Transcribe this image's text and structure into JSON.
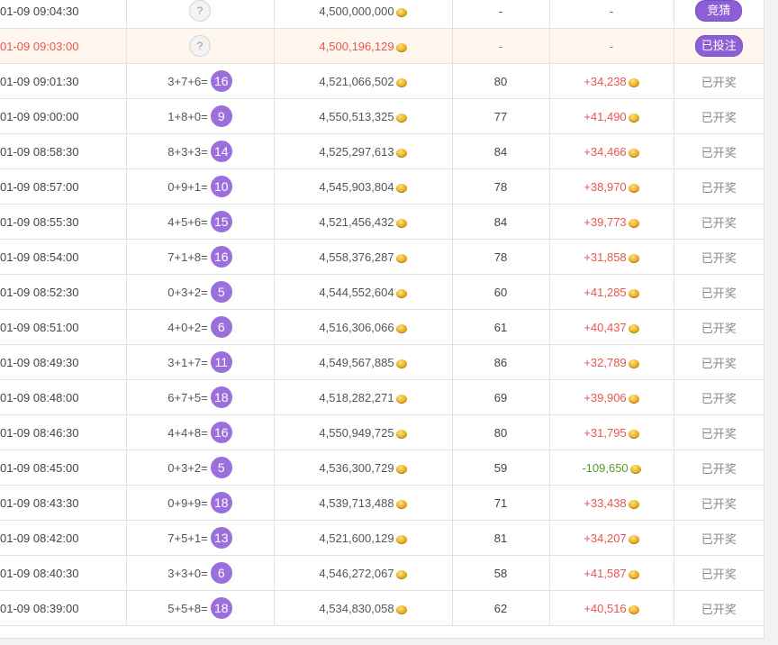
{
  "rows": [
    {
      "time": "01-09 09:04:30",
      "status": "pending",
      "pool": "4,500,000,000",
      "winners": "-",
      "profit": "-",
      "action": "竞猜",
      "action_type": "button"
    },
    {
      "time": "01-09 09:03:00",
      "status": "pending",
      "pool": "4,500,196,129",
      "winners": "-",
      "profit": "-",
      "action": "已投注",
      "action_type": "button",
      "current": true
    },
    {
      "time": "01-09 09:01:30",
      "expr": "3+7+6=",
      "sum": "16",
      "pool": "4,521,066,502",
      "winners": "80",
      "profit": "+34,238",
      "action": "已开奖"
    },
    {
      "time": "01-09 09:00:00",
      "expr": "1+8+0=",
      "sum": "9",
      "pool": "4,550,513,325",
      "winners": "77",
      "profit": "+41,490",
      "action": "已开奖"
    },
    {
      "time": "01-09 08:58:30",
      "expr": "8+3+3=",
      "sum": "14",
      "pool": "4,525,297,613",
      "winners": "84",
      "profit": "+34,466",
      "action": "已开奖"
    },
    {
      "time": "01-09 08:57:00",
      "expr": "0+9+1=",
      "sum": "10",
      "pool": "4,545,903,804",
      "winners": "78",
      "profit": "+38,970",
      "action": "已开奖"
    },
    {
      "time": "01-09 08:55:30",
      "expr": "4+5+6=",
      "sum": "15",
      "pool": "4,521,456,432",
      "winners": "84",
      "profit": "+39,773",
      "action": "已开奖"
    },
    {
      "time": "01-09 08:54:00",
      "expr": "7+1+8=",
      "sum": "16",
      "pool": "4,558,376,287",
      "winners": "78",
      "profit": "+31,858",
      "action": "已开奖"
    },
    {
      "time": "01-09 08:52:30",
      "expr": "0+3+2=",
      "sum": "5",
      "pool": "4,544,552,604",
      "winners": "60",
      "profit": "+41,285",
      "action": "已开奖"
    },
    {
      "time": "01-09 08:51:00",
      "expr": "4+0+2=",
      "sum": "6",
      "pool": "4,516,306,066",
      "winners": "61",
      "profit": "+40,437",
      "action": "已开奖"
    },
    {
      "time": "01-09 08:49:30",
      "expr": "3+1+7=",
      "sum": "11",
      "pool": "4,549,567,885",
      "winners": "86",
      "profit": "+32,789",
      "action": "已开奖"
    },
    {
      "time": "01-09 08:48:00",
      "expr": "6+7+5=",
      "sum": "18",
      "pool": "4,518,282,271",
      "winners": "69",
      "profit": "+39,906",
      "action": "已开奖"
    },
    {
      "time": "01-09 08:46:30",
      "expr": "4+4+8=",
      "sum": "16",
      "pool": "4,550,949,725",
      "winners": "80",
      "profit": "+31,795",
      "action": "已开奖"
    },
    {
      "time": "01-09 08:45:00",
      "expr": "0+3+2=",
      "sum": "5",
      "pool": "4,536,300,729",
      "winners": "59",
      "profit": "-109,650",
      "action": "已开奖",
      "negative": true
    },
    {
      "time": "01-09 08:43:30",
      "expr": "0+9+9=",
      "sum": "18",
      "pool": "4,539,713,488",
      "winners": "71",
      "profit": "+33,438",
      "action": "已开奖"
    },
    {
      "time": "01-09 08:42:00",
      "expr": "7+5+1=",
      "sum": "13",
      "pool": "4,521,600,129",
      "winners": "81",
      "profit": "+34,207",
      "action": "已开奖"
    },
    {
      "time": "01-09 08:40:30",
      "expr": "3+3+0=",
      "sum": "6",
      "pool": "4,546,272,067",
      "winners": "58",
      "profit": "+41,587",
      "action": "已开奖"
    },
    {
      "time": "01-09 08:39:00",
      "expr": "5+5+8=",
      "sum": "18",
      "pool": "4,534,830,058",
      "winners": "62",
      "profit": "+40,516",
      "action": "已开奖"
    }
  ],
  "pending_symbol": "?",
  "colors": {
    "badge": "#9b6fdc",
    "button": "#8c5fd6",
    "positive": "#e8564f",
    "negative": "#5b9a2b",
    "current_row_bg": "#fff7ee"
  },
  "icons": {
    "coin": "coin-icon",
    "unknown": "question-mark-icon"
  }
}
